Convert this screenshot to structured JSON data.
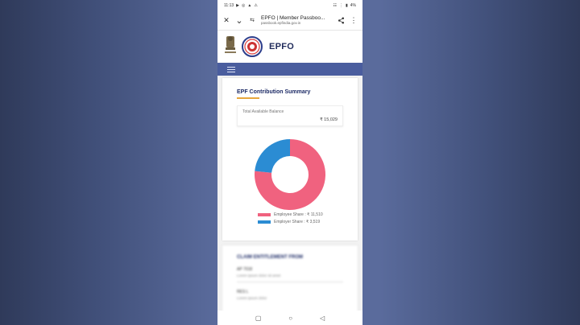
{
  "statusbar": {
    "time": "11:13",
    "icons_left": [
      "▶",
      "◎",
      "▲",
      "⚠"
    ],
    "icons_right": [
      "☷",
      "⋮",
      "▮",
      "4%"
    ]
  },
  "browser": {
    "close_icon": "✕",
    "collapse_icon": "⌄",
    "settings_icon": "⇆",
    "title": "EPFO | Member Passboo...",
    "url": "passbook.epfindia.gov.in",
    "share_icon": "<",
    "menu_icon": "⋮"
  },
  "header": {
    "brand": "EPFO",
    "emblem_caption": "सत्यमेव जयते"
  },
  "summary": {
    "title": "EPF Contribution Summary",
    "balance_label": "Total Available Balance",
    "balance_value": "₹ 15,029"
  },
  "chart_data": {
    "type": "pie",
    "categories": [
      "Employee Share",
      "Employer Share"
    ],
    "values": [
      11510,
      3519
    ],
    "colors": [
      "#f0627f",
      "#2b8cd3"
    ],
    "legend": [
      "Employee Share : ₹ 11,510",
      "Employer Share : ₹ 3,519"
    ]
  },
  "blurred_card": {
    "title": "CLAIM ENTITLEMENT FROM",
    "rows": [
      {
        "label": "AP 7018",
        "sub": "Lorem ipsum dolor sit amet"
      },
      {
        "label": "RES L",
        "sub": "Lorem ipsum dolor"
      }
    ]
  },
  "navbar_bottom": {
    "recent_icon": "▢",
    "home_icon": "○",
    "back_icon": "◁"
  }
}
